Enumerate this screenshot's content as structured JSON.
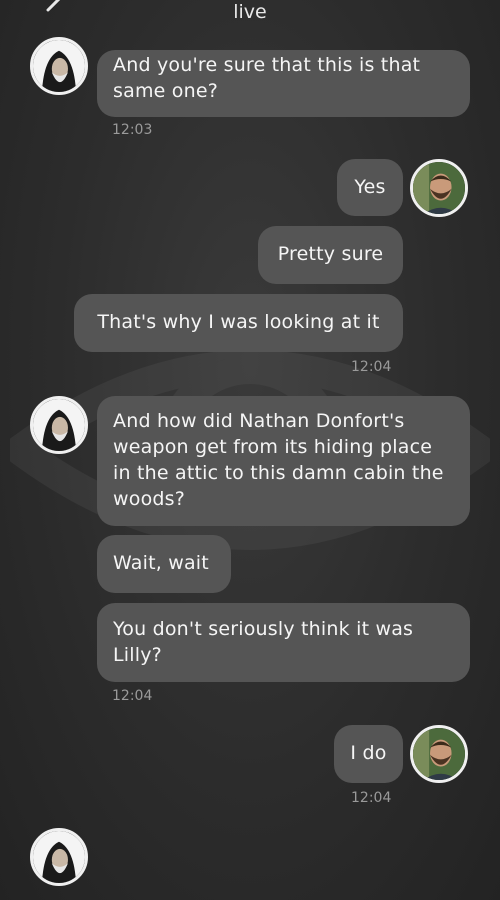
{
  "header": {
    "title": "live"
  },
  "messages": [
    {
      "text": "And you're sure that this is that same one?"
    },
    {
      "text": "Yes"
    },
    {
      "text": "Pretty sure"
    },
    {
      "text": "That's why I was looking at it"
    },
    {
      "text": "And how did Nathan Donfort's weapon get from its hiding place in the attic to this damn cabin the woods?"
    },
    {
      "text": "Wait, wait"
    },
    {
      "text": "You don't seriously think it was Lilly?"
    },
    {
      "text": "I do"
    }
  ],
  "timestamps": [
    "12:03",
    "12:04",
    "12:04",
    "12:04"
  ],
  "avatars": {
    "contact": "hooded-man-avatar",
    "user": "bearded-man-avatar"
  },
  "colors": {
    "bubble": "#555555",
    "background": "#2c2c2c",
    "timestamp": "#9a9a9a"
  }
}
